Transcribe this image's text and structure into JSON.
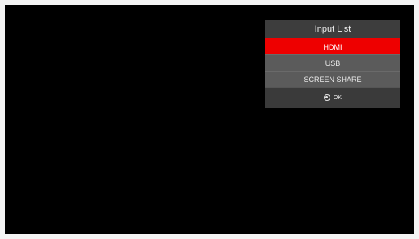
{
  "input_list": {
    "title": "Input List",
    "items": [
      {
        "label": "HDMI",
        "selected": true
      },
      {
        "label": "USB",
        "selected": false
      },
      {
        "label": "SCREEN SHARE",
        "selected": false
      }
    ],
    "footer": {
      "icon": "ok-button-icon",
      "label": "OK"
    }
  },
  "colors": {
    "selected": "#ee0000",
    "panel": "#3a3a3a",
    "item": "#5b5b5b",
    "screen": "#000000"
  }
}
